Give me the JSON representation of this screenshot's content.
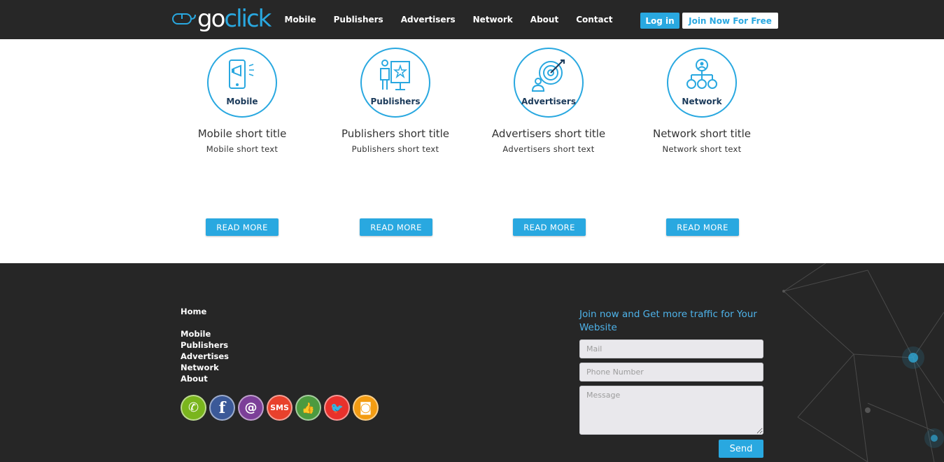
{
  "header": {
    "logo": {
      "part1": "go",
      "part2": "click"
    },
    "nav": [
      "Mobile",
      "Publishers",
      "Advertisers",
      "Network",
      "About",
      "Contact"
    ],
    "login_label": "Log in",
    "join_label": "Join Now For Free"
  },
  "features": [
    {
      "icon_label": "Mobile",
      "title": "Mobile short title",
      "text": "Mobile short text",
      "button": "READ MORE"
    },
    {
      "icon_label": "Publishers",
      "title": "Publishers short title",
      "text": "Publishers short text",
      "button": "READ MORE"
    },
    {
      "icon_label": "Advertisers",
      "title": "Advertisers short title",
      "text": "Advertisers short text",
      "button": "READ MORE"
    },
    {
      "icon_label": "Network",
      "title": "Network short title",
      "text": "Network short text",
      "button": "READ MORE"
    }
  ],
  "footer": {
    "links": [
      "Home",
      "Mobile",
      "Publishers",
      "Advertises",
      "Network",
      "About"
    ],
    "social": [
      {
        "icon": "phone-icon",
        "glyph": "✆",
        "color": "#7ab51d"
      },
      {
        "icon": "facebook-icon",
        "glyph": "f",
        "color": "#3b5998"
      },
      {
        "icon": "email-icon",
        "glyph": "@",
        "color": "#7c3f98"
      },
      {
        "icon": "sms-icon",
        "glyph": "SMS",
        "color": "#e8412c"
      },
      {
        "icon": "like-icon",
        "glyph": "👍",
        "color": "#4c9a3f"
      },
      {
        "icon": "twitter-icon",
        "glyph": "🐦",
        "color": "#e8312c"
      },
      {
        "icon": "instagram-icon",
        "glyph": "◙",
        "color": "#f39c12"
      }
    ],
    "join_heading": "Join now and Get more traffic for Your Website",
    "form": {
      "mail_placeholder": "Mail",
      "phone_placeholder": "Phone Number",
      "message_placeholder": "Message",
      "send_label": "Send"
    }
  },
  "colors": {
    "accent": "#29a8e0",
    "header_bg": "#272727",
    "footer_bg": "#262626"
  }
}
